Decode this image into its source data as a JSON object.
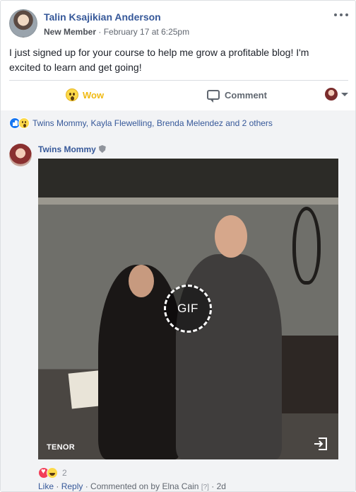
{
  "post": {
    "author_name": "Talin Ksajikian Anderson",
    "member_role": "New Member",
    "separator": " · ",
    "timestamp": "February 17 at 6:25pm",
    "text": "I just signed up for your course to help me grow a profitable blog! I'm excited to learn and get going!",
    "avatar_icon": "profile-photo"
  },
  "actions": {
    "wow_label": "Wow",
    "wow_color": "#f0ba15",
    "comment_label": "Comment"
  },
  "reactions_summary": {
    "icons": [
      "like-icon",
      "wow-icon"
    ],
    "text": "Twins Mommy, Kayla Flewelling, Brenda Melendez and 2 others"
  },
  "comment": {
    "author_name": "Twins Mommy",
    "badge_icon": "shield-icon",
    "gif": {
      "badge_label": "GIF",
      "source_label": "TENOR"
    },
    "reaction_count": "2",
    "reaction_icons": [
      "love-icon",
      "haha-icon"
    ],
    "like_label": "Like",
    "reply_label": "Reply",
    "dot": " · ",
    "commented_on_by": "Commented on by",
    "commented_by_name": "Elna Cain",
    "help_marker": "[?]",
    "age": "2d"
  },
  "colors": {
    "link": "#365899",
    "meta_text": "#616770",
    "comment_bg": "#f2f3f5",
    "like_blue": "#1877f2",
    "love_red": "#f33e58"
  }
}
